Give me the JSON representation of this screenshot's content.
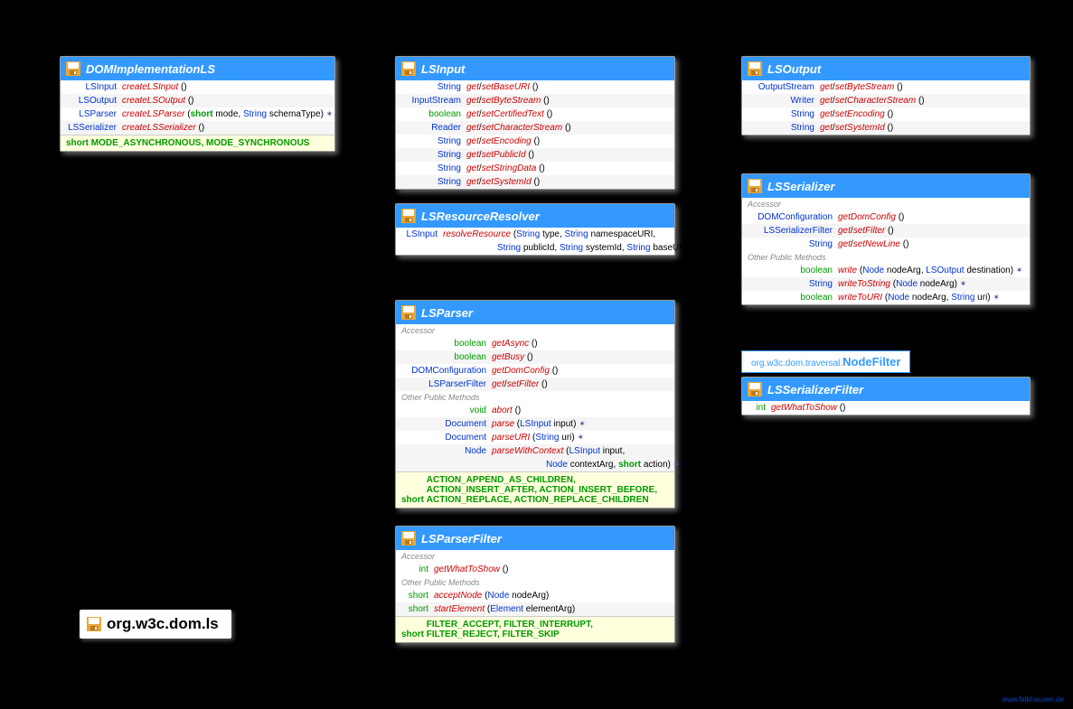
{
  "package": "org.w3c.dom.ls",
  "watermark": "www.falkhausen.de",
  "nodefilter": {
    "pkg": "org.w3c.dom.traversal.",
    "cls": "NodeFilter"
  },
  "boxes": {
    "dom_impl": {
      "title": "DOMImplementationLS",
      "rows": [
        {
          "ret": "LSInput",
          "name": "createLSInput",
          "params": "()"
        },
        {
          "ret": "LSOutput",
          "name": "createLSOutput",
          "params": "()"
        },
        {
          "ret": "LSParser",
          "name": "createLSParser",
          "params_html": "(<span class='kw-short'>short</span> <span class='pname'>mode</span>, <span class='ptype'>String</span> <span class='pname'>schemaType</span>) <span class='exc'>✶</span>"
        },
        {
          "ret": "LSSerializer",
          "name": "createLSSerializer",
          "params": "()"
        }
      ],
      "consts": "MODE_ASYNCHRONOUS, MODE_SYNCHRONOUS",
      "ctype": "short"
    },
    "lsinput": {
      "title": "LSInput",
      "rows": [
        {
          "ret": "String",
          "gs": true,
          "name": "BaseURI"
        },
        {
          "ret": "InputStream",
          "gs": true,
          "name": "ByteStream"
        },
        {
          "ret": "boolean",
          "gs": true,
          "name": "CertifiedText"
        },
        {
          "ret": "Reader",
          "gs": true,
          "name": "CharacterStream"
        },
        {
          "ret": "String",
          "gs": true,
          "name": "Encoding"
        },
        {
          "ret": "String",
          "gs": true,
          "name": "PublicId"
        },
        {
          "ret": "String",
          "gs": true,
          "name": "StringData"
        },
        {
          "ret": "String",
          "gs": true,
          "name": "SystemId"
        }
      ]
    },
    "resolver": {
      "title": "LSResourceResolver",
      "rows": [
        {
          "ret": "LSInput",
          "name": "resolveResource",
          "params_html": "(<span class='ptype'>String</span> <span class='pname'>type</span>, <span class='ptype'>String</span> <span class='pname'>namespaceURI</span>,",
          "line2_html": "<span class='ptype'>String</span> <span class='pname'>publicId</span>, <span class='ptype'>String</span> <span class='pname'>systemId</span>, <span class='ptype'>String</span> <span class='pname'>baseURI</span>)"
        }
      ]
    },
    "lsparser": {
      "title": "LSParser",
      "sections": {
        "accessor": "Accessor",
        "other": "Other Public Methods"
      },
      "acc": [
        {
          "ret": "boolean",
          "name": "getAsync",
          "params": "()"
        },
        {
          "ret": "boolean",
          "name": "getBusy",
          "params": "()"
        },
        {
          "ret": "DOMConfiguration",
          "name": "getDomConfig",
          "params": "()"
        },
        {
          "ret": "LSParserFilter",
          "gs": true,
          "name": "Filter"
        }
      ],
      "other": [
        {
          "ret": "void",
          "name": "abort",
          "params": "()"
        },
        {
          "ret": "Document",
          "name": "parse",
          "params_html": "(<span class='ptype'>LSInput</span> <span class='pname'>input</span>) <span class='exc'>✶</span>"
        },
        {
          "ret": "Document",
          "name": "parseURI",
          "params_html": "(<span class='ptype'>String</span> <span class='pname'>uri</span>) <span class='exc'>✶</span>"
        },
        {
          "ret": "Node",
          "name": "parseWithContext",
          "params_html": "(<span class='ptype'>LSInput</span> <span class='pname'>input</span>,",
          "line2_html": "<span class='ptype'>Node</span> <span class='pname'>contextArg</span>, <span class='kw-short'>short</span> <span class='pname'>action</span>) <span class='exc'>✶</span>"
        }
      ],
      "consts": "ACTION_APPEND_AS_CHILDREN, ACTION_INSERT_AFTER, ACTION_INSERT_BEFORE, ACTION_REPLACE, ACTION_REPLACE_CHILDREN",
      "ctype": "short"
    },
    "parserfilter": {
      "title": "LSParserFilter",
      "sections": {
        "accessor": "Accessor",
        "other": "Other Public Methods"
      },
      "acc": [
        {
          "ret": "int",
          "name": "getWhatToShow",
          "params": "()"
        }
      ],
      "other": [
        {
          "ret": "short",
          "name": "acceptNode",
          "params_html": "(<span class='ptype'>Node</span> <span class='pname'>nodeArg</span>)"
        },
        {
          "ret": "short",
          "name": "startElement",
          "params_html": "(<span class='ptype'>Element</span> <span class='pname'>elementArg</span>)"
        }
      ],
      "consts": "FILTER_ACCEPT, FILTER_INTERRUPT, FILTER_REJECT, FILTER_SKIP",
      "ctype": "short"
    },
    "lsoutput": {
      "title": "LSOutput",
      "rows": [
        {
          "ret": "OutputStream",
          "gs": true,
          "name": "ByteStream"
        },
        {
          "ret": "Writer",
          "gs": true,
          "name": "CharacterStream"
        },
        {
          "ret": "String",
          "gs": true,
          "name": "Encoding"
        },
        {
          "ret": "String",
          "gs": true,
          "name": "SystemId"
        }
      ]
    },
    "serializer": {
      "title": "LSSerializer",
      "sections": {
        "accessor": "Accessor",
        "other": "Other Public Methods"
      },
      "acc": [
        {
          "ret": "DOMConfiguration",
          "name": "getDomConfig",
          "params": "()"
        },
        {
          "ret": "LSSerializerFilter",
          "gs": true,
          "name": "Filter"
        },
        {
          "ret": "String",
          "gs": true,
          "name": "NewLine"
        }
      ],
      "other": [
        {
          "ret": "boolean",
          "name": "write",
          "params_html": "(<span class='ptype'>Node</span> <span class='pname'>nodeArg</span>, <span class='ptype'>LSOutput</span> <span class='pname'>destination</span>) <span class='exc'>✶</span>"
        },
        {
          "ret": "String",
          "name": "writeToString",
          "params_html": "(<span class='ptype'>Node</span> <span class='pname'>nodeArg</span>) <span class='exc'>✶</span>"
        },
        {
          "ret": "boolean",
          "name": "writeToURI",
          "params_html": "(<span class='ptype'>Node</span> <span class='pname'>nodeArg</span>, <span class='ptype'>String</span> <span class='pname'>uri</span>) <span class='exc'>✶</span>"
        }
      ]
    },
    "serfilter": {
      "title": "LSSerializerFilter",
      "rows": [
        {
          "ret": "int",
          "name": "getWhatToShow",
          "params": "()"
        }
      ]
    }
  }
}
